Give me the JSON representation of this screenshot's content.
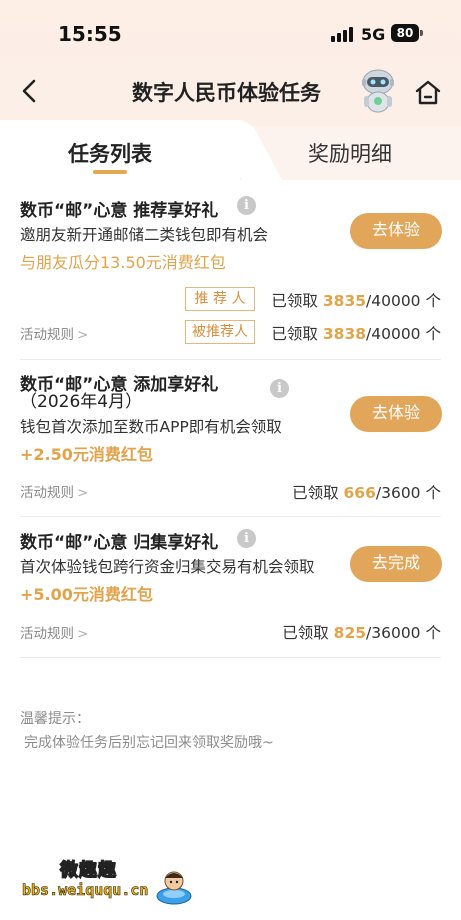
{
  "status_bar": {
    "time": "15:55",
    "network": "5G",
    "battery": "80"
  },
  "header": {
    "title": "数字人民币体验任务"
  },
  "tabs": [
    {
      "label": "任务列表",
      "active": true
    },
    {
      "label": "奖励明细",
      "active": false
    }
  ],
  "tasks": [
    {
      "title": "数币“邮”心意 推荐享好礼",
      "description": "邀朋友新开通邮储二类钱包即有机会",
      "reward": "与朋友瓜分13.50元消费红包",
      "button": "去体验",
      "rules": "活动规则",
      "rows": [
        {
          "role": "推 荐 人",
          "claimed_label": "已领取",
          "claimed": "3835",
          "total": "/40000",
          "unit": "个"
        },
        {
          "role": "被推荐人",
          "claimed_label": "已领取",
          "claimed": "3838",
          "total": "/40000",
          "unit": "个"
        }
      ]
    },
    {
      "title": "数币“邮”心意 添加享好礼",
      "title_line2": "（2026年4月）",
      "description": "钱包首次添加至数币APP即有机会领取",
      "reward": "+2.50元消费红包",
      "button": "去体验",
      "rules": "活动规则",
      "claimed_label": "已领取",
      "claimed": "666",
      "total": "/3600",
      "unit": "个"
    },
    {
      "title": "数币“邮”心意 归集享好礼",
      "description": "首次体验钱包跨行资金归集交易有机会领取",
      "reward": "+5.00元消费红包",
      "button": "去完成",
      "rules": "活动规则",
      "claimed_label": "已领取",
      "claimed": "825",
      "total": "/36000",
      "unit": "个"
    }
  ],
  "tips": {
    "title": "温馨提示：",
    "body": "完成体验任务后别忘记回来领取奖励哦~"
  },
  "watermark": {
    "title": "微趣趣",
    "url": "bbs.weiququ.cn"
  },
  "colors": {
    "accent": "#e2a65a",
    "accent_text": "#e3a34a",
    "header_bg": "#fdeee6"
  },
  "icons": {
    "back": "chevron-left-icon",
    "home": "home-icon",
    "info": "info-icon",
    "mascot": "robot-mascot-icon"
  }
}
